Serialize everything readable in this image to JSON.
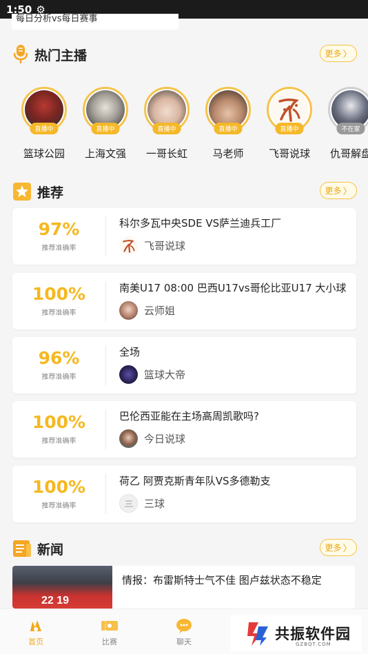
{
  "status_bar": {
    "time": "1:50",
    "icon": "gear-icon"
  },
  "top_card": {
    "text": "每日分析vs每日赛事"
  },
  "hot_hosts": {
    "title": "热门主播",
    "more": "更多",
    "hosts": [
      {
        "name": "篮球公园",
        "badge": "直播中",
        "live": true
      },
      {
        "name": "上海文强",
        "badge": "直播中",
        "live": true
      },
      {
        "name": "一哥长虹",
        "badge": "直播中",
        "live": true
      },
      {
        "name": "马老师",
        "badge": "直播中",
        "live": true
      },
      {
        "name": "飞哥说球",
        "badge": "直播中",
        "live": true
      },
      {
        "name": "仇哥解盘",
        "badge": "不在家",
        "live": false
      }
    ]
  },
  "recommend": {
    "title": "推荐",
    "more": "更多",
    "rate_label": "推荐准确率",
    "items": [
      {
        "rate": "97%",
        "title": "科尔多瓦中央SDE VS萨兰迪兵工厂",
        "author": "飞哥说球"
      },
      {
        "rate": "100%",
        "title": "南美U17 08:00 巴西U17vs哥伦比亚U17 大小球",
        "author": "云师姐"
      },
      {
        "rate": "96%",
        "title": "全场",
        "author": "篮球大帝"
      },
      {
        "rate": "100%",
        "title": "巴伦西亚能在主场高周凯歌吗?",
        "author": "今日说球"
      },
      {
        "rate": "100%",
        "title": "荷乙 阿贾克斯青年队VS多德勒支",
        "author": "三球"
      }
    ]
  },
  "news": {
    "title": "新闻",
    "more": "更多",
    "items": [
      {
        "title": "情报：布雷斯特士气不佳 图卢兹状态不稳定",
        "jersey_numbers": "22  19"
      }
    ]
  },
  "bottom_nav": {
    "items": [
      {
        "label": "首页",
        "active": true,
        "icon": "home-icon"
      },
      {
        "label": "比赛",
        "active": false,
        "icon": "ticket-icon"
      },
      {
        "label": "聊天",
        "active": false,
        "icon": "chat-icon"
      }
    ]
  },
  "watermark": {
    "text": "共振软件园",
    "sub": "GZBQT.COM"
  },
  "colors": {
    "accent": "#f5b820",
    "badge_live": "#f4b829",
    "badge_off": "#9a9a9a"
  }
}
